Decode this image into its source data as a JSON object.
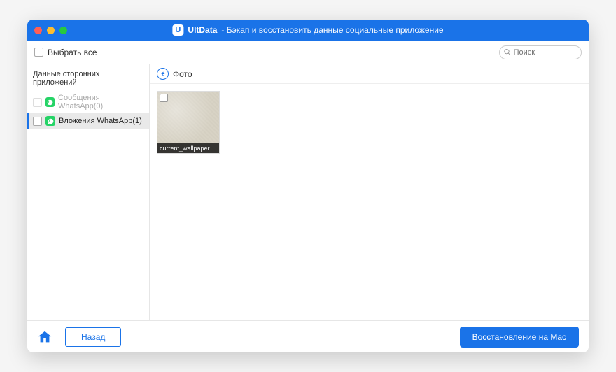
{
  "title": {
    "app": "UltData",
    "subtitle": "- Бэкап и восстановить данные социальные приложение"
  },
  "toolbar": {
    "select_all": "Выбрать все",
    "search_placeholder": "Поиск"
  },
  "sidebar": {
    "section_title": "Данные сторонних приложений",
    "items": [
      {
        "label": "Сообщения WhatsApp(0)"
      },
      {
        "label": "Вложения WhatsApp(1)"
      }
    ]
  },
  "breadcrumb": {
    "label": "Фото"
  },
  "grid": {
    "items": [
      {
        "filename": "current_wallpaper.jpg"
      }
    ]
  },
  "footer": {
    "back": "Назад",
    "restore": "Восстановление на Mac"
  }
}
